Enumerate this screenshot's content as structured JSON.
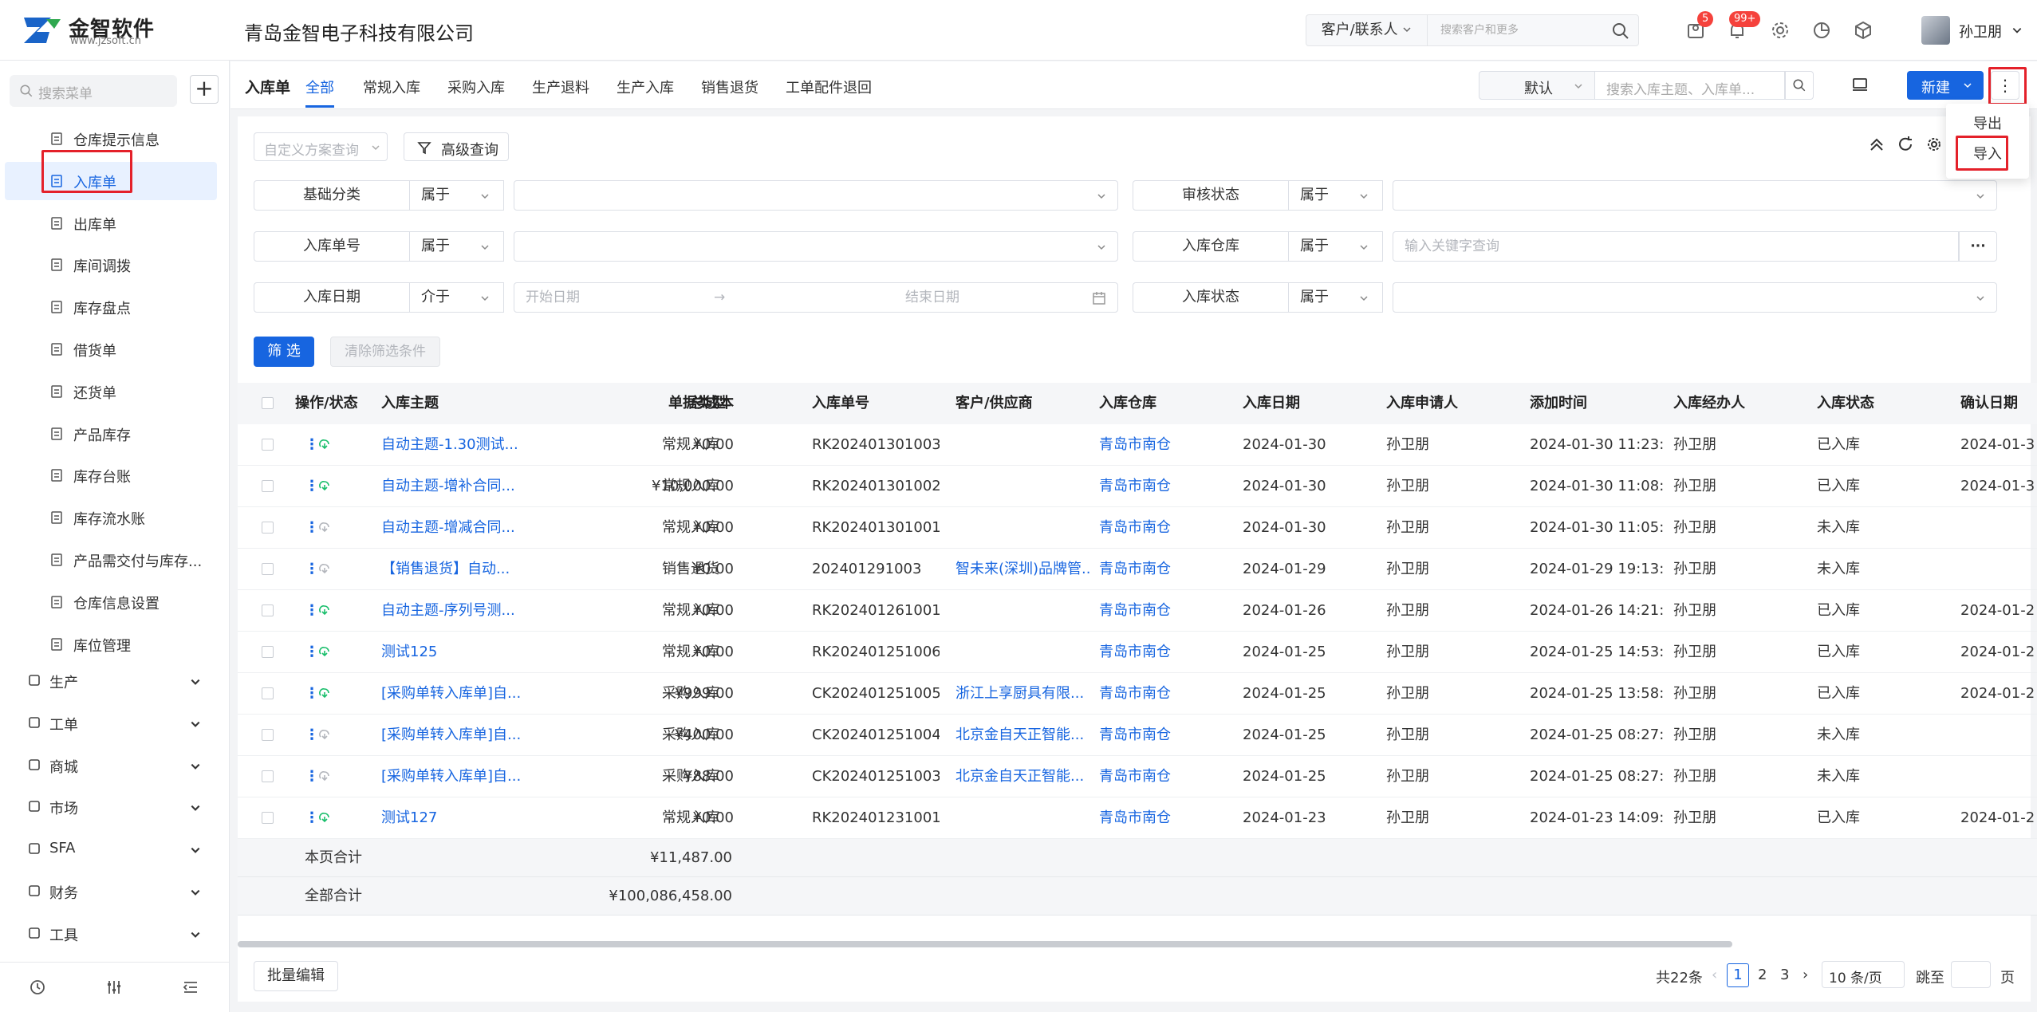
{
  "app": {
    "logo_text": "金智软件",
    "logo_url": "www.jzsoft.cn",
    "company": "青岛金智电子科技有限公司",
    "search_type": "客户/联系人",
    "search_placeholder": "搜索客户和更多",
    "badge_tasks": "5",
    "badge_notifications": "99+",
    "user_name": "孙卫朋"
  },
  "sidebar": {
    "search_placeholder": "搜索菜单",
    "items": [
      {
        "label": "仓库提示信息",
        "icon": "list-icon"
      },
      {
        "label": "入库单",
        "icon": "inbound-doc-icon",
        "active": true
      },
      {
        "label": "出库单",
        "icon": "outbound-icon"
      },
      {
        "label": "库间调拨",
        "icon": "transfer-icon"
      },
      {
        "label": "库存盘点",
        "icon": "stocktake-icon"
      },
      {
        "label": "借货单",
        "icon": "borrow-icon"
      },
      {
        "label": "还货单",
        "icon": "return-icon"
      },
      {
        "label": "产品库存",
        "icon": "product-stock-icon"
      },
      {
        "label": "库存台账",
        "icon": "ledger-icon"
      },
      {
        "label": "库存流水账",
        "icon": "journal-icon"
      },
      {
        "label": "产品需交付与库存...",
        "icon": "delivery-icon"
      },
      {
        "label": "仓库信息设置",
        "icon": "settings-icon"
      },
      {
        "label": "库位管理",
        "icon": "location-icon"
      }
    ],
    "groups": [
      {
        "label": "生产",
        "icon": "production-icon"
      },
      {
        "label": "工单",
        "icon": "workorder-icon"
      },
      {
        "label": "商城",
        "icon": "mall-icon"
      },
      {
        "label": "市场",
        "icon": "market-icon"
      },
      {
        "label": "SFA",
        "icon": "sfa-icon"
      },
      {
        "label": "财务",
        "icon": "finance-icon"
      },
      {
        "label": "工具",
        "icon": "tools-icon"
      }
    ]
  },
  "tabbar": {
    "title": "入库单",
    "tabs": [
      "全部",
      "常规入库",
      "采购入库",
      "生产退料",
      "生产入库",
      "销售退货",
      "工单配件退回"
    ],
    "view": "默认",
    "search_placeholder": "搜索入库主题、入库单...",
    "new_label": "新建",
    "more_menu": [
      "导出",
      "导入"
    ]
  },
  "filters": {
    "scheme_placeholder": "自定义方案查询",
    "advanced": "高级查询",
    "rows": [
      {
        "label": "基础分类",
        "op": "属于",
        "value": ""
      },
      {
        "label": "审核状态",
        "op": "属于",
        "value": ""
      },
      {
        "label": "入库单号",
        "op": "属于",
        "value": ""
      },
      {
        "label": "入库仓库",
        "op": "属于",
        "placeholder": "输入关键字查询"
      },
      {
        "label": "入库日期",
        "op": "介于",
        "start": "开始日期",
        "end": "结束日期"
      },
      {
        "label": "入库状态",
        "op": "属于",
        "value": ""
      }
    ],
    "submit": "筛 选",
    "clear": "清除筛选条件"
  },
  "table": {
    "columns": [
      "操作/状态",
      "入库主题",
      "总成本",
      "单据类型",
      "入库单号",
      "客户/供应商",
      "入库仓库",
      "入库日期",
      "入库申请人",
      "添加时间",
      "入库经办人",
      "入库状态",
      "确认日期"
    ],
    "rows": [
      {
        "subject": "自动主题-1.30测试...",
        "cost": "¥0.00",
        "type": "常规入库",
        "no": "RK202401301003",
        "partner": "",
        "warehouse": "青岛市南仓",
        "date": "2024-01-30",
        "applicant": "孙卫朋",
        "added": "2024-01-30 11:23:...",
        "handler": "孙卫朋",
        "status": "已入库",
        "confirm": "2024-01-3",
        "done": true
      },
      {
        "subject": "自动主题-增补合同...",
        "cost": "¥10,000.00",
        "type": "常规入库",
        "no": "RK202401301002",
        "partner": "",
        "warehouse": "青岛市南仓",
        "date": "2024-01-30",
        "applicant": "孙卫朋",
        "added": "2024-01-30 11:08:...",
        "handler": "孙卫朋",
        "status": "已入库",
        "confirm": "2024-01-3",
        "done": true
      },
      {
        "subject": "自动主题-增减合同...",
        "cost": "¥0.00",
        "type": "常规入库",
        "no": "RK202401301001",
        "partner": "",
        "warehouse": "青岛市南仓",
        "date": "2024-01-30",
        "applicant": "孙卫朋",
        "added": "2024-01-30 11:05:...",
        "handler": "孙卫朋",
        "status": "未入库",
        "confirm": "",
        "done": false
      },
      {
        "subject": "【销售退货】自动...",
        "cost": "¥0.00",
        "type": "销售退货",
        "no": "202401291003",
        "partner": "智未来(深圳)品牌管...",
        "warehouse": "青岛市南仓",
        "date": "2024-01-29",
        "applicant": "孙卫朋",
        "added": "2024-01-29 19:13:...",
        "handler": "孙卫朋",
        "status": "未入库",
        "confirm": "",
        "done": false
      },
      {
        "subject": "自动主题-序列号测...",
        "cost": "¥0.00",
        "type": "常规入库",
        "no": "RK202401261001",
        "partner": "",
        "warehouse": "青岛市南仓",
        "date": "2024-01-26",
        "applicant": "孙卫朋",
        "added": "2024-01-26 14:21:...",
        "handler": "孙卫朋",
        "status": "已入库",
        "confirm": "2024-01-2",
        "done": true
      },
      {
        "subject": "测试125",
        "cost": "¥0.00",
        "type": "常规入库",
        "no": "RK202401251006",
        "partner": "",
        "warehouse": "青岛市南仓",
        "date": "2024-01-25",
        "applicant": "孙卫朋",
        "added": "2024-01-25 14:53:...",
        "handler": "孙卫朋",
        "status": "已入库",
        "confirm": "2024-01-2",
        "done": true
      },
      {
        "subject": "[采购单转入库单]自...",
        "cost": "¥999.00",
        "type": "采购入库",
        "no": "CK202401251005",
        "partner": "浙江上享厨具有限...",
        "warehouse": "青岛市南仓",
        "date": "2024-01-25",
        "applicant": "孙卫朋",
        "added": "2024-01-25 13:58:...",
        "handler": "孙卫朋",
        "status": "已入库",
        "confirm": "2024-01-2",
        "done": true
      },
      {
        "subject": "[采购单转入库单]自...",
        "cost": "¥400.00",
        "type": "采购入库",
        "no": "CK202401251004",
        "partner": "北京金自天正智能...",
        "warehouse": "青岛市南仓",
        "date": "2024-01-25",
        "applicant": "孙卫朋",
        "added": "2024-01-25 08:27:...",
        "handler": "孙卫朋",
        "status": "未入库",
        "confirm": "",
        "done": false
      },
      {
        "subject": "[采购单转入库单]自...",
        "cost": "¥88.00",
        "type": "采购入库",
        "no": "CK202401251003",
        "partner": "北京金自天正智能...",
        "warehouse": "青岛市南仓",
        "date": "2024-01-25",
        "applicant": "孙卫朋",
        "added": "2024-01-25 08:27:...",
        "handler": "孙卫朋",
        "status": "未入库",
        "confirm": "",
        "done": false
      },
      {
        "subject": "测试127",
        "cost": "¥0.00",
        "type": "常规入库",
        "no": "RK202401231001",
        "partner": "",
        "warehouse": "青岛市南仓",
        "date": "2024-01-23",
        "applicant": "孙卫朋",
        "added": "2024-01-23 14:09:...",
        "handler": "孙卫朋",
        "status": "已入库",
        "confirm": "2024-01-2",
        "done": true
      }
    ],
    "page_total_label": "本页合计",
    "page_total": "¥11,487.00",
    "all_total_label": "全部合计",
    "all_total": "¥100,086,458.00"
  },
  "footer": {
    "batch_edit": "批量编辑",
    "total": "共22条",
    "pages": [
      "1",
      "2",
      "3"
    ],
    "page_size": "10 条/页",
    "jump": "跳至",
    "page_unit": "页"
  },
  "colors": {
    "accent": "#1765e0",
    "highlight": "#e4212a",
    "status_green": "#19be6b"
  }
}
